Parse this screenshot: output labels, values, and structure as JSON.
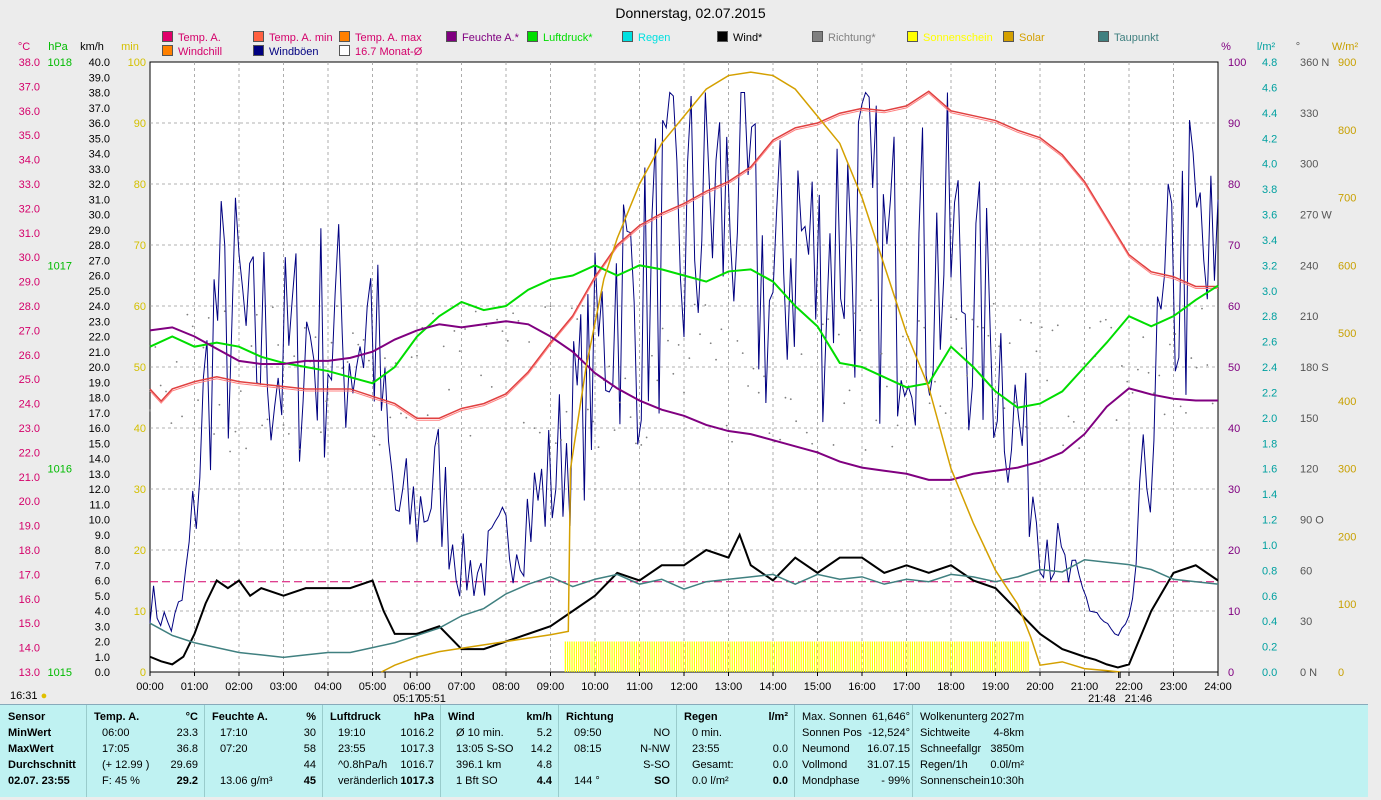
{
  "chart_data": {
    "type": "line",
    "title": "Donnerstag, 02.07.2015",
    "x_ticks": [
      "00:00",
      "01:00",
      "02:00",
      "03:00",
      "04:00",
      "05:00",
      "06:00",
      "07:00",
      "08:00",
      "09:00",
      "10:00",
      "11:00",
      "12:00",
      "13:00",
      "14:00",
      "15:00",
      "16:00",
      "17:00",
      "18:00",
      "19:00",
      "20:00",
      "21:00",
      "22:00",
      "23:00",
      "24:00"
    ],
    "axes": {
      "temp": {
        "unit": "°C",
        "min": 13.0,
        "max": 38.0,
        "step": 1.0,
        "color": "#d4006a"
      },
      "pressure": {
        "unit": "hPa",
        "ticks": [
          1015,
          1016,
          1017,
          1018
        ],
        "min": 1015,
        "max": 1018,
        "color": "#00bb00"
      },
      "wind": {
        "unit": "km/h",
        "min": 0.0,
        "max": 40.0,
        "step": 1.0,
        "color": "#000000"
      },
      "sunshine": {
        "unit": "min",
        "min": 0,
        "max": 100,
        "step": 10,
        "color": "#d4c000"
      },
      "humidity": {
        "unit": "%",
        "min": 0,
        "max": 100,
        "step": 10,
        "color": "#800080"
      },
      "rain": {
        "unit": "l/m²",
        "min": 0.0,
        "max": 4.8,
        "step": 0.2,
        "color": "#00a0a0"
      },
      "direction": {
        "unit": "°",
        "ticks": [
          0,
          30,
          60,
          90,
          120,
          150,
          180,
          210,
          240,
          270,
          300,
          330,
          360
        ],
        "labels": {
          "0": "N",
          "90": "O",
          "180": "S",
          "270": "W",
          "360": "N"
        }
      },
      "solar": {
        "unit": "W/m²",
        "min": 0,
        "max": 900,
        "step": 100,
        "color": "#c8a000"
      }
    },
    "legend": [
      {
        "name": "Temp. A.",
        "color": "#e0006a"
      },
      {
        "name": "Temp. A. min",
        "color": "#ff6040"
      },
      {
        "name": "Temp. A. max",
        "color": "#ff8000"
      },
      {
        "name": "Feuchte A.*",
        "color": "#800080"
      },
      {
        "name": "Luftdruck*",
        "color": "#00dd00"
      },
      {
        "name": "Regen",
        "color": "#00e0e0"
      },
      {
        "name": "Wind*",
        "color": "#000000"
      },
      {
        "name": "Richtung*",
        "color": "#808080"
      },
      {
        "name": "Sonnenschein",
        "color": "#ffff00"
      },
      {
        "name": "Solar",
        "color": "#d4a000"
      },
      {
        "name": "Taupunkt",
        "color": "#408080"
      },
      {
        "name": "Windchill",
        "color": "#ff8000"
      },
      {
        "name": "Windböen",
        "color": "#000080"
      },
      {
        "name": "16.7 Monat-Ø",
        "color": "#ffffff"
      }
    ],
    "monthly_avg_temp": 16.7,
    "series": [
      {
        "name": "Temp. A.",
        "axis": "temp",
        "color": "#e04040",
        "x": [
          0,
          0.25,
          0.5,
          1,
          1.5,
          2,
          2.5,
          3,
          3.5,
          4,
          4.5,
          5,
          5.5,
          6,
          6.5,
          7,
          7.5,
          8,
          8.5,
          9,
          9.5,
          10,
          10.5,
          11,
          11.5,
          12,
          12.5,
          13,
          13.5,
          14,
          14.5,
          15,
          15.5,
          16,
          16.5,
          17,
          17.5,
          18,
          18.5,
          19,
          19.5,
          20,
          20.5,
          21,
          21.5,
          22,
          22.5,
          23,
          23.5,
          24
        ],
        "y": [
          24.6,
          24.1,
          24.6,
          24.9,
          25.1,
          24.9,
          24.8,
          24.7,
          24.6,
          24.6,
          24.6,
          24.3,
          24.0,
          23.4,
          23.4,
          23.8,
          24.0,
          24.4,
          25.3,
          26.5,
          27.6,
          29.2,
          30.5,
          31.3,
          31.8,
          32.2,
          32.7,
          33.1,
          33.7,
          34.8,
          35.3,
          35.5,
          35.9,
          36.1,
          36.0,
          36.2,
          36.8,
          36.0,
          35.8,
          35.6,
          35.2,
          34.9,
          34.2,
          33.1,
          31.6,
          30.1,
          29.4,
          29.2,
          28.8,
          28.8
        ]
      },
      {
        "name": "Luftdruck*",
        "axis": "pressure",
        "color": "#00dd00",
        "x": [
          0,
          0.5,
          1,
          1.5,
          2,
          2.5,
          3,
          3.5,
          4,
          4.5,
          5,
          5.5,
          6,
          6.5,
          7,
          7.5,
          8,
          8.5,
          9,
          9.5,
          10,
          10.5,
          11,
          11.5,
          12,
          12.5,
          13,
          13.5,
          14,
          14.5,
          15,
          15.5,
          16,
          16.5,
          17,
          17.5,
          18,
          18.5,
          19,
          19.5,
          20,
          20.5,
          21,
          21.5,
          22,
          22.5,
          23,
          23.5,
          24
        ],
        "y": [
          1016.6,
          1016.65,
          1016.6,
          1016.62,
          1016.6,
          1016.55,
          1016.52,
          1016.5,
          1016.48,
          1016.45,
          1016.42,
          1016.5,
          1016.65,
          1016.75,
          1016.82,
          1016.78,
          1016.8,
          1016.88,
          1016.93,
          1016.95,
          1017.0,
          1016.95,
          1017.0,
          1016.98,
          1016.95,
          1016.92,
          1016.97,
          1016.98,
          1016.92,
          1016.8,
          1016.7,
          1016.52,
          1016.5,
          1016.45,
          1016.4,
          1016.42,
          1016.6,
          1016.5,
          1016.38,
          1016.3,
          1016.32,
          1016.38,
          1016.5,
          1016.62,
          1016.75,
          1016.7,
          1016.75,
          1016.83,
          1016.9
        ]
      },
      {
        "name": "Feuchte A.*",
        "axis": "humidity",
        "color": "#800080",
        "x": [
          0,
          0.5,
          1,
          1.5,
          2,
          2.5,
          3,
          3.5,
          4,
          4.5,
          5,
          5.5,
          6,
          6.5,
          7,
          7.5,
          8,
          8.5,
          9,
          9.5,
          10,
          10.5,
          11,
          11.5,
          12,
          12.5,
          13,
          13.5,
          14,
          14.5,
          15,
          15.5,
          16,
          16.5,
          17,
          17.5,
          18,
          18.5,
          19,
          19.5,
          20,
          20.5,
          21,
          21.5,
          22,
          22.5,
          23,
          23.5,
          24
        ],
        "y": [
          56,
          56.5,
          55,
          53,
          51,
          50.5,
          50.5,
          51,
          51,
          51.5,
          52.5,
          54.5,
          56,
          57,
          56.5,
          57,
          57.5,
          57,
          55,
          52.5,
          49,
          46.5,
          44.5,
          43,
          42,
          40.5,
          39.5,
          39,
          38,
          37,
          36,
          34.5,
          33.5,
          33,
          32.5,
          31.5,
          31.5,
          32.5,
          33,
          33.5,
          34.5,
          36,
          39,
          43.5,
          46.5,
          45.5,
          44.8,
          44.5,
          44.5
        ]
      },
      {
        "name": "Wind*",
        "axis": "wind",
        "color": "#000000",
        "x": [
          0,
          0.25,
          0.5,
          0.75,
          1,
          1.25,
          1.5,
          1.75,
          2,
          2.25,
          2.5,
          3,
          3.5,
          4,
          4.5,
          5,
          5.25,
          5.5,
          6,
          6.5,
          7,
          7.5,
          8,
          8.5,
          9,
          9.5,
          10,
          10.5,
          11,
          11.5,
          12,
          12.5,
          13,
          13.25,
          13.5,
          14,
          14.5,
          15,
          15.5,
          16,
          16.5,
          17,
          17.5,
          18,
          18.5,
          19,
          19.5,
          20,
          20.5,
          21,
          21.25,
          21.5,
          21.75,
          22,
          22.5,
          23,
          23.5,
          24
        ],
        "y": [
          1.0,
          0.7,
          0.5,
          1.0,
          2.5,
          4.5,
          6.0,
          5.5,
          6.0,
          5.0,
          5.5,
          5.0,
          5.5,
          5.5,
          5.5,
          6.0,
          4.0,
          2.5,
          2.5,
          3.0,
          1.5,
          1.5,
          2.0,
          2.5,
          3.0,
          4.0,
          5.0,
          6.5,
          6.0,
          7.0,
          7.0,
          8.0,
          7.5,
          9.0,
          7.0,
          6.0,
          7.5,
          6.5,
          7.5,
          7.5,
          6.5,
          7.0,
          6.5,
          7.0,
          6.0,
          5.5,
          4.0,
          2.5,
          1.5,
          1.0,
          0.8,
          0.5,
          0.3,
          0.5,
          4.0,
          6.5,
          7.0,
          6.0
        ]
      },
      {
        "name": "Taupunkt",
        "axis": "temp",
        "color": "#408080",
        "x": [
          0,
          0.5,
          1,
          1.5,
          2,
          2.5,
          3,
          3.5,
          4,
          4.5,
          5,
          5.5,
          6,
          6.5,
          7,
          7.5,
          8,
          8.5,
          9,
          9.5,
          10,
          10.5,
          11,
          11.5,
          12,
          12.5,
          13,
          13.5,
          14,
          14.5,
          15,
          15.5,
          16,
          16.5,
          17,
          17.5,
          18,
          18.5,
          19,
          19.5,
          20,
          20.5,
          21,
          21.5,
          22,
          22.5,
          23,
          23.5,
          24
        ],
        "y": [
          15.0,
          14.5,
          14.2,
          14.0,
          13.8,
          13.7,
          13.6,
          13.7,
          13.8,
          13.8,
          14.0,
          14.2,
          14.5,
          14.8,
          15.3,
          15.6,
          16.2,
          16.6,
          16.9,
          16.5,
          16.8,
          17.0,
          16.6,
          16.8,
          16.4,
          16.7,
          16.8,
          16.9,
          17.0,
          16.6,
          17.0,
          16.8,
          16.9,
          16.6,
          16.8,
          16.7,
          17.0,
          16.9,
          16.7,
          16.9,
          17.2,
          17.1,
          17.6,
          17.5,
          17.4,
          17.2,
          16.8,
          16.7,
          16.6
        ]
      },
      {
        "name": "Solar",
        "axis": "solar",
        "color": "#d4a000",
        "x": [
          5.2,
          5.5,
          6,
          6.5,
          7,
          7.5,
          8,
          8.5,
          9,
          9.4,
          9.45,
          9.8,
          10.2,
          10.5,
          11,
          11.5,
          12,
          12.5,
          13,
          13.5,
          14,
          14.5,
          15,
          15.5,
          16,
          16.5,
          17,
          17.5,
          18,
          18.5,
          19,
          19.5,
          19.8,
          20,
          20.5,
          21,
          21.5,
          21.8
        ],
        "y": [
          0,
          10,
          22,
          30,
          35,
          40,
          45,
          50,
          55,
          60,
          300,
          450,
          580,
          640,
          720,
          780,
          820,
          860,
          880,
          885,
          880,
          860,
          820,
          780,
          700,
          600,
          500,
          420,
          300,
          220,
          150,
          100,
          50,
          10,
          15,
          5,
          2,
          0
        ]
      }
    ],
    "gust_color": "#000080",
    "sunshine_bars": {
      "axis": "sunshine",
      "color": "#ffff00",
      "from": "09:20",
      "to": "19:45",
      "value": 5
    },
    "markers": [
      {
        "label": "05:17",
        "time": "05:17",
        "kind": "sunrise"
      },
      {
        "label": "05:51",
        "time": "05:51",
        "kind": "sunrise"
      },
      {
        "label": "21:48",
        "time": "21:48",
        "kind": "sunset"
      },
      {
        "label": "21:46",
        "time": "21:46",
        "kind": "sunset"
      }
    ]
  },
  "status_time": "16:31",
  "footer": {
    "sensor": {
      "header": "Sensor",
      "rows": [
        "MinWert",
        "MaxWert",
        "Durchschnitt",
        "02.07. 23:55"
      ]
    },
    "temp": {
      "header": "Temp. A.",
      "unit": "°C",
      "rows": [
        [
          "06:00",
          "23.3"
        ],
        [
          "17:05",
          "36.8"
        ],
        [
          "(+ 12.99 )",
          "29.69"
        ],
        [
          "F: 45 %",
          "29.2"
        ]
      ]
    },
    "feuchte": {
      "header": "Feuchte A.",
      "unit": "%",
      "rows": [
        [
          "17:10",
          "30"
        ],
        [
          "07:20",
          "58"
        ],
        [
          "",
          "44"
        ],
        [
          "13.06 g/m³",
          "45"
        ]
      ]
    },
    "luftdruck": {
      "header": "Luftdruck",
      "unit": "hPa",
      "rows": [
        [
          "19:10",
          "1016.2"
        ],
        [
          "23:55",
          "1017.3"
        ],
        [
          "^0.8hPa/h",
          "1016.7"
        ],
        [
          "veränderlich",
          "1017.3"
        ]
      ]
    },
    "wind": {
      "header": "Wind",
      "unit": "km/h",
      "rows": [
        [
          "Ø 10 min.",
          "5.2"
        ],
        [
          "13:05    S-SO",
          "14.2"
        ],
        [
          "396.1 km",
          "4.8"
        ],
        [
          "1 Bft SO",
          "4.4"
        ]
      ]
    },
    "richtung": {
      "header": "Richtung",
      "rows": [
        [
          "09:50",
          "NO"
        ],
        [
          "08:15",
          "N-NW"
        ],
        [
          "",
          "S-SO"
        ],
        [
          "144 °",
          "SO"
        ]
      ]
    },
    "regen": {
      "header": "Regen",
      "unit": "l/m²",
      "rows": [
        [
          "0 min.",
          ""
        ],
        [
          "23:55",
          "0.0"
        ],
        [
          "Gesamt:",
          "0.0"
        ],
        [
          "0.0 l/m²",
          "0.0"
        ]
      ]
    },
    "sonne": {
      "rows": [
        [
          "Max. Sonnen",
          "61,646°"
        ],
        [
          "Sonnen Pos",
          "-12,524°"
        ],
        [
          "Neumond",
          "16.07.15"
        ],
        [
          "Vollmond",
          "31.07.15"
        ],
        [
          "Mondphase",
          "- 99%"
        ]
      ]
    },
    "wolken": {
      "rows": [
        [
          "Wolkenunterg",
          "2027m"
        ],
        [
          "Sichtweite",
          "4-8km"
        ],
        [
          "Schneefallgr",
          "3850m"
        ],
        [
          "Regen/1h",
          "0.0l/m²"
        ],
        [
          "Sonnenschein",
          "10:30h"
        ]
      ]
    }
  }
}
